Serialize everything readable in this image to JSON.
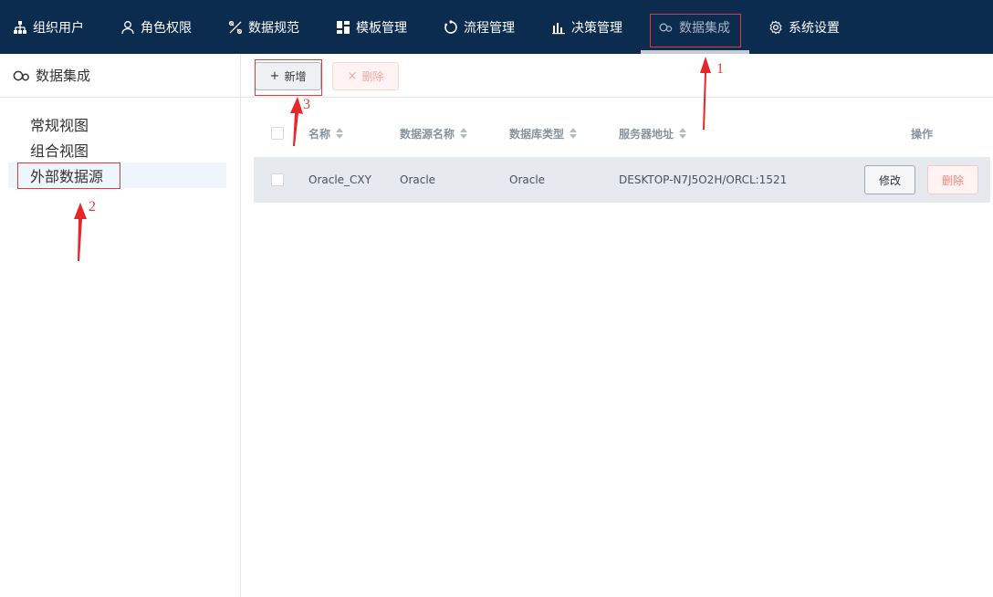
{
  "nav": {
    "items": [
      {
        "label": "组织用户",
        "icon": "org-tree-icon"
      },
      {
        "label": "角色权限",
        "icon": "user-icon"
      },
      {
        "label": "数据规范",
        "icon": "tools-icon"
      },
      {
        "label": "模板管理",
        "icon": "template-icon"
      },
      {
        "label": "流程管理",
        "icon": "cycle-icon"
      },
      {
        "label": "决策管理",
        "icon": "bar-chart-icon"
      },
      {
        "label": "数据集成",
        "icon": "data-integration-icon",
        "active": true
      },
      {
        "label": "系统设置",
        "icon": "gear-icon"
      }
    ]
  },
  "sidebar": {
    "title": "数据集成",
    "items": [
      {
        "label": "常规视图"
      },
      {
        "label": "组合视图"
      },
      {
        "label": "外部数据源",
        "selected": true
      }
    ]
  },
  "toolbar": {
    "add_label": "新增",
    "delete_label": "删除"
  },
  "table": {
    "columns": [
      "名称",
      "数据源名称",
      "数据库类型",
      "服务器地址",
      "操作"
    ],
    "rows": [
      {
        "name": "Oracle_CXY",
        "source_name": "Oracle",
        "db_type": "Oracle",
        "server": "DESKTOP-N7J5O2H/ORCL:1521",
        "edit_label": "修改",
        "delete_label": "删除"
      }
    ]
  },
  "annotations": [
    "1",
    "2",
    "3"
  ],
  "colors": {
    "nav_bg": "#0b2c4f",
    "annotation_red": "#e23b3b",
    "row_bg": "#e6eaef",
    "selected_bg": "#eef5fd"
  }
}
